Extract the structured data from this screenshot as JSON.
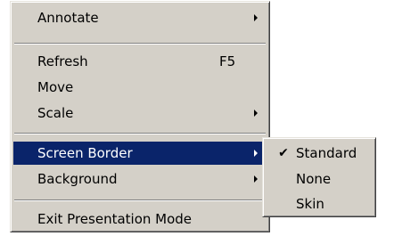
{
  "context_menu": {
    "items": [
      {
        "label": "Annotate",
        "has_submenu": true
      },
      {
        "label": "Refresh",
        "shortcut": "F5"
      },
      {
        "label": "Move"
      },
      {
        "label": "Scale",
        "has_submenu": true
      },
      {
        "label": "Screen Border",
        "has_submenu": true,
        "highlighted": true
      },
      {
        "label": "Background",
        "has_submenu": true
      },
      {
        "label": "Exit Presentation Mode"
      }
    ]
  },
  "screen_border_submenu": {
    "items": [
      {
        "label": "Standard",
        "checked": true
      },
      {
        "label": "None"
      },
      {
        "label": "Skin"
      }
    ],
    "check_glyph": "✔"
  },
  "colors": {
    "menu_background": "#d4d0c8",
    "highlight_background": "#0a246a",
    "highlight_text": "#ffffff"
  }
}
